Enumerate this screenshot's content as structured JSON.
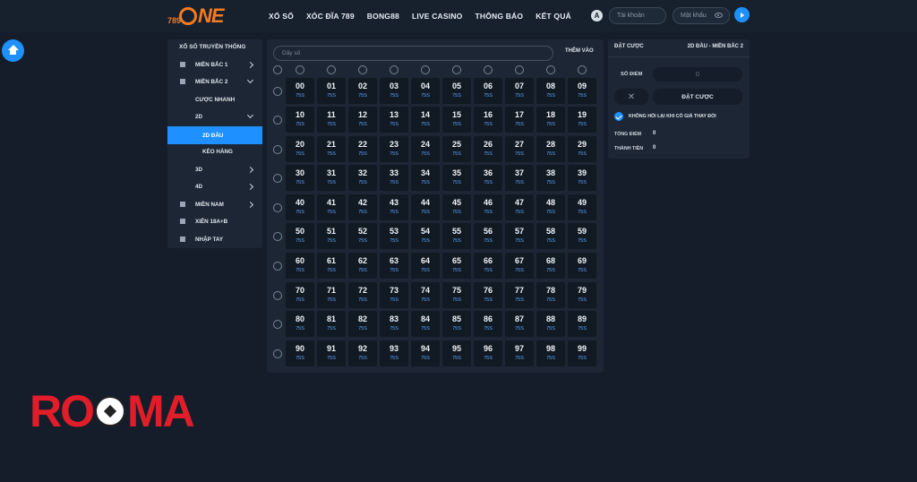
{
  "header": {
    "logo_num": "789",
    "logo_word": "NE",
    "nav": [
      "XỔ SỐ",
      "XÓC ĐĨA 789",
      "BONG88",
      "LIVE CASINO",
      "THÔNG BÁO",
      "KẾT QUẢ"
    ],
    "username_placeholder": "Tài khoản",
    "password_placeholder": "Mật khẩu"
  },
  "sidebar": {
    "title": "XỔ SỐ TRUYỀN THỐNG",
    "items": [
      {
        "label": "MIỀN BẮC 1"
      },
      {
        "label": "MIỀN BẮC 2"
      },
      {
        "label": "CƯỢC NHANH"
      },
      {
        "label": "2D"
      },
      {
        "label": "2D ĐẦU"
      },
      {
        "label": "KÉO HÀNG"
      },
      {
        "label": "3D"
      },
      {
        "label": "4D"
      },
      {
        "label": "MIỀN NAM"
      },
      {
        "label": "XIÊN 18A+B"
      },
      {
        "label": "NHẬP TAY"
      }
    ]
  },
  "grid": {
    "input_placeholder": "Dãy số",
    "add_label": "THÊM VÀO",
    "odds": "75S"
  },
  "bet": {
    "title": "ĐẶT CƯỢC",
    "info": "2D ĐẦU - MIỀN BẮC 2",
    "points_label": "SỐ ĐIỂM",
    "points_value": "0",
    "clear": "✕",
    "place": "ĐẶT CƯỢC",
    "confirm_label": "KHÔNG HỎI LẠI KHI CÓ GIÁ THAY ĐỔI",
    "total_points_label": "TỔNG ĐIỂM",
    "total_points": "0",
    "amount_label": "THÀNH TIỀN",
    "amount": "0"
  },
  "watermark": {
    "left": "RO",
    "right": "MA"
  }
}
